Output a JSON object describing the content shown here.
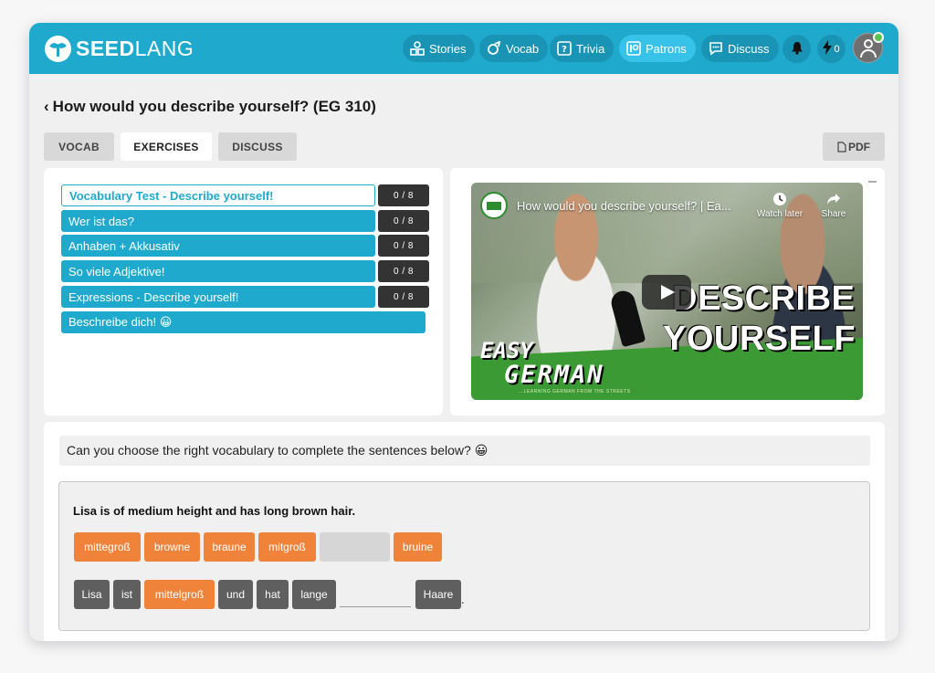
{
  "header": {
    "logo_bold": "SEED",
    "logo_rest": "LANG",
    "nav": [
      {
        "label": "Stories",
        "icon": "stories-icon"
      },
      {
        "label": "Vocab",
        "icon": "vocab-icon"
      },
      {
        "label": "Trivia",
        "icon": "trivia-icon"
      },
      {
        "label": "Patrons",
        "icon": "patreon-icon"
      },
      {
        "label": "Discuss",
        "icon": "discuss-icon"
      }
    ],
    "energy_count": "0",
    "accent_color": "#1ea9cd"
  },
  "page": {
    "back": "‹",
    "title": "How would you describe yourself? (EG 310)"
  },
  "tabs": [
    "VOCAB",
    "EXERCISES",
    "DISCUSS"
  ],
  "pdf_label": "PDF",
  "exercises": [
    {
      "label": "Vocabulary Test - Describe yourself!",
      "count": "0 / 8"
    },
    {
      "label": "Wer ist das?",
      "count": "0 / 8"
    },
    {
      "label": "Anhaben + Akkusativ",
      "count": "0 / 8"
    },
    {
      "label": "So viele Adjektive!",
      "count": "0 / 8"
    },
    {
      "label": "Expressions - Describe yourself!",
      "count": "0 / 8"
    },
    {
      "label": "Beschreibe dich! 😀",
      "count": ""
    }
  ],
  "video": {
    "title": "How would you describe yourself? | Ea...",
    "watch_later": "Watch later",
    "share": "Share",
    "overlay_line1": "DESCRIBE",
    "overlay_line2": "YOURSELF",
    "brand_line1": "EASY",
    "brand_line2": "GERMAN",
    "tagline": "...LEARNING GERMAN FROM THE STREETS"
  },
  "question": {
    "prompt": "Can you choose the right vocabulary to complete the sentences below? 😀",
    "sentence": "Lisa is of medium height and has long brown hair.",
    "choices": [
      "mittegroß",
      "browne",
      "braune",
      "mitgroß",
      "",
      "bruine"
    ],
    "answer_words": [
      "Lisa",
      "ist",
      "mittelgroß",
      "und",
      "hat",
      "lange",
      "Haare"
    ],
    "period": "."
  }
}
